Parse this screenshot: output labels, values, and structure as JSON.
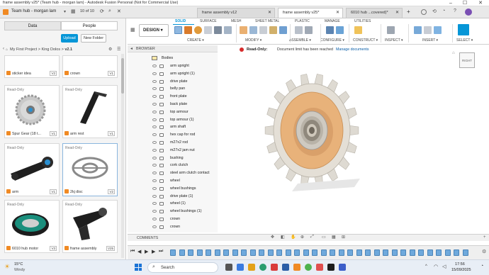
{
  "window": {
    "title": "frame assembly v25* (Team hub - morgan lam) - Autodesk Fusion Personal (Not for Commercial Use)",
    "controls": [
      "–",
      "☐",
      "✕"
    ]
  },
  "header": {
    "team": "Team hub - morgan lam",
    "counter": "10 of 10",
    "tabs": [
      {
        "label": "frame assembly v12",
        "active": false
      },
      {
        "label": "frame assembly v25*",
        "active": true
      },
      {
        "label": "6010 hub ...covered)*",
        "active": false
      }
    ]
  },
  "data_panel": {
    "tabs": [
      "Data",
      "People"
    ],
    "upload_label": "Upload",
    "new_folder_label": "New Folder",
    "breadcrumb": [
      "My First Project",
      "King Dolos",
      "v2.1"
    ],
    "files": [
      {
        "name": "sticker idea",
        "version": "V2",
        "read_only": false
      },
      {
        "name": "crown",
        "version": "V1",
        "read_only": false
      },
      {
        "name": "Spur Gear (18 t...",
        "version": "V1",
        "read_only": true
      },
      {
        "name": "arm rest",
        "version": "V1",
        "read_only": true
      },
      {
        "name": "arm",
        "version": "V1",
        "read_only": true
      },
      {
        "name": "2kj disc",
        "version": "V2",
        "read_only": true
      },
      {
        "name": "6010 hub motor",
        "version": "V3",
        "read_only": true
      },
      {
        "name": "frame assembly",
        "version": "V25",
        "read_only": true
      }
    ],
    "read_only_label": "Read-Only"
  },
  "toolbar": {
    "workspace": "DESIGN",
    "tabs": [
      "SOLID",
      "SURFACE",
      "MESH",
      "SHEET METAL",
      "PLASTIC",
      "MANAGE",
      "UTILITIES"
    ],
    "groups": [
      "CREATE",
      "MODIFY",
      "ASSEMBLE",
      "CONFIGURE",
      "CONSTRUCT",
      "INSPECT",
      "INSERT",
      "SELECT"
    ]
  },
  "browser": {
    "title": "BROWSER",
    "root": "Bodies",
    "items": [
      "arm upright",
      "arm upright (1)",
      "drive plate",
      "belly pan",
      "front plate",
      "back plate",
      "top armour",
      "top armour (1)",
      "arm shaft",
      "hex cap for rod",
      "m27x2 rod",
      "m27x2 jam nut",
      "bushing",
      "cork clutch",
      "steel arm clutch contact",
      "wheel",
      "wheel bushings",
      "drive plate (1)",
      "wheel (1)",
      "wheel bushings (1)",
      "crown",
      "crown"
    ]
  },
  "notice": {
    "label": "Read-Only:",
    "message": "Document limit has been reached",
    "action": "Manage documents"
  },
  "viewcube": {
    "label": "RIGHT"
  },
  "comments": {
    "label": "COMMENTS"
  },
  "taskbar": {
    "weather_temp": "15°C",
    "weather_desc": "Windy",
    "search_placeholder": "Search",
    "time": "17:56",
    "date": "15/09/2025"
  },
  "colors": {
    "accent": "#0696d7",
    "gear_face": "#e8b27a",
    "gear_teeth": "#ddd8cf"
  }
}
